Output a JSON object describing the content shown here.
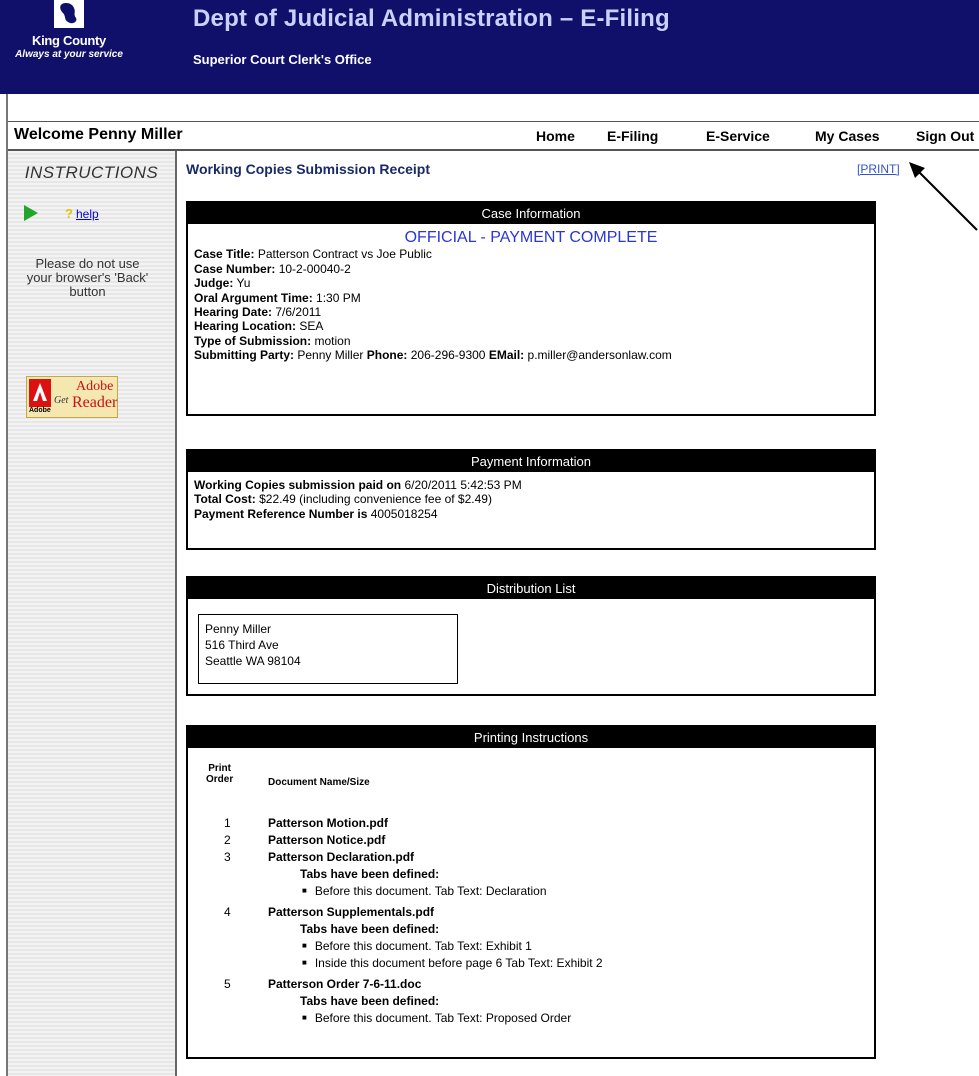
{
  "header": {
    "org_name": "King County",
    "org_tagline": "Always at your service",
    "title": "Dept of Judicial Administration – E-Filing",
    "subtitle": "Superior Court Clerk's Office"
  },
  "nav": {
    "welcome": "Welcome Penny Miller",
    "links": [
      "Home",
      "E-Filing",
      "E-Service",
      "My Cases",
      "Sign Out"
    ]
  },
  "sidebar": {
    "instructions": "INSTRUCTIONS",
    "help": "help",
    "back_note": [
      "Please do not use",
      "your browser's 'Back'",
      "button"
    ],
    "adobe": {
      "brand": "Adobe",
      "get": "Get",
      "product1": "Adobe",
      "product2": "Reader"
    }
  },
  "receipt": {
    "title": "Working Copies Submission Receipt",
    "print_link": "[PRINT]"
  },
  "case_info": {
    "header": "Case Information",
    "status": "OFFICIAL - PAYMENT COMPLETE",
    "fields": [
      {
        "label": "Case Title:",
        "value": "Patterson Contract vs Joe Public"
      },
      {
        "label": "Case Number:",
        "value": "10-2-00040-2"
      },
      {
        "label": "Judge:",
        "value": "Yu"
      },
      {
        "label": "Oral Argument Time:",
        "value": "1:30 PM"
      },
      {
        "label": "Hearing Date:",
        "value": "7/6/2011"
      },
      {
        "label": "Hearing Location:",
        "value": "SEA"
      },
      {
        "label": "Type of Submission:",
        "value": "motion"
      }
    ],
    "party_label": "Submitting Party:",
    "party_value": "Penny Miller",
    "phone_label": "Phone:",
    "phone_value": "206-296-9300",
    "email_label": "EMail:",
    "email_value": "p.miller@andersonlaw.com"
  },
  "payment": {
    "header": "Payment Information",
    "paid_label": "Working Copies submission paid on",
    "paid_value": "6/20/2011 5:42:53 PM",
    "cost_label": "Total Cost:",
    "cost_value": "$22.49 (including convenience fee of $2.49)",
    "ref_label": "Payment Reference Number is",
    "ref_value": "4005018254"
  },
  "distribution": {
    "header": "Distribution List",
    "address": [
      "Penny Miller",
      "516 Third Ave",
      "Seattle WA 98104"
    ]
  },
  "printing": {
    "header": "Printing Instructions",
    "col_print": "Print",
    "col_order": "Order",
    "col_doc": "Document Name/Size",
    "tabs_defined": "Tabs have been defined:",
    "documents": [
      {
        "order": "1",
        "name": "Patterson Motion.pdf",
        "tabs": []
      },
      {
        "order": "2",
        "name": "Patterson Notice.pdf",
        "tabs": []
      },
      {
        "order": "3",
        "name": "Patterson Declaration.pdf",
        "tabs": [
          "Before this document. Tab Text: Declaration"
        ]
      },
      {
        "order": "4",
        "name": "Patterson Supplementals.pdf",
        "tabs": [
          "Before this document. Tab Text: Exhibit 1",
          "Inside this document before page 6 Tab Text: Exhibit 2"
        ]
      },
      {
        "order": "5",
        "name": "Patterson Order 7-6-11.doc",
        "tabs": [
          "Before this document. Tab Text: Proposed Order"
        ]
      }
    ]
  },
  "colors": {
    "header_bg": "#10106b",
    "title": "#c9d2ff",
    "status_blue": "#2b35d8",
    "link": "#3355cc"
  }
}
